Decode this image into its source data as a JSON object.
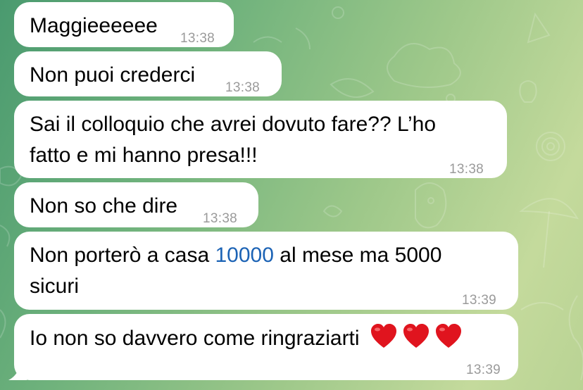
{
  "messages": [
    {
      "text": "Maggieeeeee",
      "time": "13:38"
    },
    {
      "text": "Non puoi crederci",
      "time": "13:38"
    },
    {
      "line1": "Sai il colloquio che avrei dovuto fare?? L’ho",
      "line2": "fatto e mi hanno presa!!!",
      "time": "13:38"
    },
    {
      "text": "Non so che dire",
      "time": "13:38"
    },
    {
      "line1_before": "Non porterò a casa ",
      "line1_number": "10000",
      "line1_after": " al mese ma 5000",
      "line2": "sicuri",
      "time": "13:39"
    },
    {
      "text": "Io non so davvero come ringraziarti",
      "hearts": [
        "red-heart-icon",
        "red-heart-icon",
        "red-heart-icon"
      ],
      "time": "13:39"
    }
  ],
  "colors": {
    "bubble": "#ffffff",
    "timestamp": "#9a9a9a",
    "number_link": "#1c63b5",
    "heart": "#e0141e",
    "wallpaper_start": "#4a9a6f",
    "wallpaper_end": "#c4da9c"
  }
}
